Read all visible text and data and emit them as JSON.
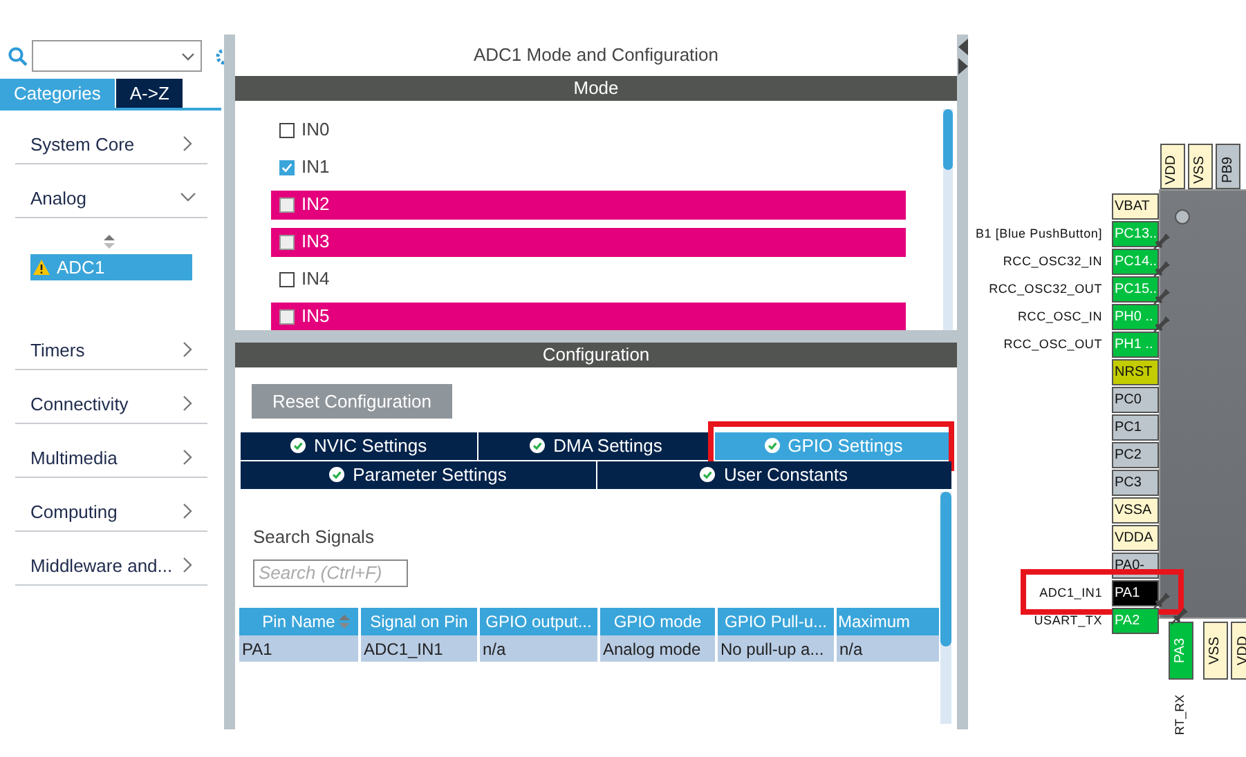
{
  "category_tabs": [
    {
      "label": "Categories",
      "selected": true
    },
    {
      "label": "A->Z",
      "selected": false
    }
  ],
  "categories": [
    {
      "label": "System Core",
      "expanded": false
    },
    {
      "label": "Analog",
      "expanded": true,
      "children": [
        {
          "label": "ADC1",
          "selected": true,
          "warning": true
        }
      ]
    },
    {
      "label": "Timers",
      "expanded": false
    },
    {
      "label": "Connectivity",
      "expanded": false
    },
    {
      "label": "Multimedia",
      "expanded": false
    },
    {
      "label": "Computing",
      "expanded": false
    },
    {
      "label": "Middleware and...",
      "expanded": false
    }
  ],
  "title": "ADC1 Mode and Configuration",
  "mode": {
    "header": "Mode",
    "channels": [
      {
        "label": "IN0",
        "checked": false,
        "conflict": false
      },
      {
        "label": "IN1",
        "checked": true,
        "conflict": false
      },
      {
        "label": "IN2",
        "checked": false,
        "conflict": true
      },
      {
        "label": "IN3",
        "checked": false,
        "conflict": true
      },
      {
        "label": "IN4",
        "checked": false,
        "conflict": false
      },
      {
        "label": "IN5",
        "checked": false,
        "conflict": true
      }
    ]
  },
  "configuration": {
    "header": "Configuration",
    "reset_button": "Reset Configuration",
    "tab_rows": [
      [
        {
          "label": "NVIC Settings",
          "selected": false,
          "marked": false
        },
        {
          "label": "DMA Settings",
          "selected": false,
          "marked": false
        },
        {
          "label": "GPIO Settings",
          "selected": true,
          "marked": true
        }
      ],
      [
        {
          "label": "Parameter Settings",
          "selected": false,
          "marked": false
        },
        {
          "label": "User Constants",
          "selected": false,
          "marked": false
        }
      ]
    ],
    "search_label": "Search Signals",
    "search_placeholder": "Search (Ctrl+F)",
    "table": {
      "columns": [
        {
          "label": "Pin Name",
          "sortable": true
        },
        {
          "label": "Signal on Pin",
          "sortable": false
        },
        {
          "label": "GPIO output...",
          "sortable": false
        },
        {
          "label": "GPIO mode",
          "sortable": false
        },
        {
          "label": "GPIO Pull-u...",
          "sortable": false
        },
        {
          "label": "Maximum",
          "sortable": false
        }
      ],
      "rows": [
        [
          "PA1",
          "ADC1_IN1",
          "n/a",
          "Analog mode",
          "No pull-up a...",
          "n/a"
        ]
      ]
    }
  },
  "chip": {
    "top_pins": [
      {
        "name": "VDD",
        "color": "#fff5cc"
      },
      {
        "name": "VSS",
        "color": "#fff5cc"
      },
      {
        "name": "PB9",
        "color": "#bcc5cc"
      }
    ],
    "left_pins": [
      {
        "name": "VBAT",
        "color": "#fff5cc",
        "pinned": false,
        "marked": false
      },
      {
        "name": "PC13..",
        "signal": "B1 [Blue PushButton]",
        "color": "#00c040",
        "pinned": true,
        "marked": false
      },
      {
        "name": "PC14..",
        "signal": "RCC_OSC32_IN",
        "color": "#00c040",
        "pinned": true,
        "marked": false
      },
      {
        "name": "PC15..",
        "signal": "RCC_OSC32_OUT",
        "color": "#00c040",
        "pinned": true,
        "marked": false
      },
      {
        "name": "PH0 ..",
        "signal": "RCC_OSC_IN",
        "color": "#00c040",
        "pinned": true,
        "marked": false
      },
      {
        "name": "PH1 ..",
        "signal": "RCC_OSC_OUT",
        "color": "#00c040",
        "pinned": false,
        "marked": false
      },
      {
        "name": "NRST",
        "color": "#c2cc00",
        "pinned": false,
        "marked": false
      },
      {
        "name": "PC0",
        "color": "#bcc5cc",
        "pinned": false,
        "marked": false
      },
      {
        "name": "PC1",
        "color": "#bcc5cc",
        "pinned": false,
        "marked": false
      },
      {
        "name": "PC2",
        "color": "#bcc5cc",
        "pinned": false,
        "marked": false
      },
      {
        "name": "PC3",
        "color": "#bcc5cc",
        "pinned": false,
        "marked": false
      },
      {
        "name": "VSSA",
        "color": "#fff5cc",
        "pinned": false,
        "marked": false
      },
      {
        "name": "VDDA",
        "color": "#fff5cc",
        "pinned": false,
        "marked": false
      },
      {
        "name": "PA0-",
        "color": "#bcc5cc",
        "pinned": false,
        "marked": false
      },
      {
        "name": "PA1",
        "signal": "ADC1_IN1",
        "color": "#000000",
        "pinned": true,
        "marked": true
      },
      {
        "name": "PA2",
        "signal": "USART_TX",
        "color": "#00c040",
        "pinned": false,
        "marked": false
      }
    ],
    "bottom_pins": [
      {
        "name": "PA3",
        "signal": "RT_RX",
        "color": "#00c040",
        "pinned": true
      },
      {
        "name": "VSS",
        "color": "#fff5cc",
        "pinned": false
      },
      {
        "name": "VDD",
        "color": "#fff5cc",
        "pinned": false
      }
    ]
  }
}
